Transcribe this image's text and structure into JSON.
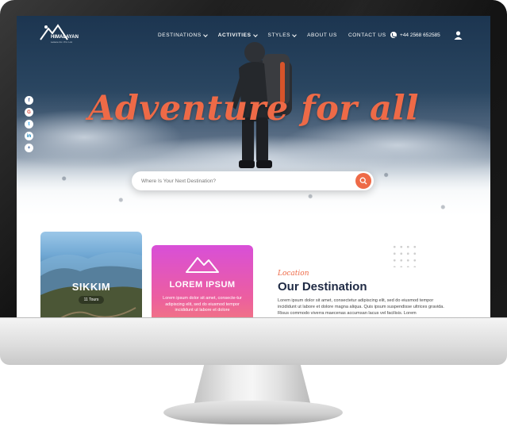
{
  "brand": {
    "name": "HIMALAYAN",
    "sub": "Leisure Inc. Pvt. Ltd."
  },
  "nav": {
    "items": [
      {
        "label": "DESTINATIONS",
        "has_dropdown": true,
        "active": false
      },
      {
        "label": "ACTIVITIES",
        "has_dropdown": true,
        "active": true
      },
      {
        "label": "STYLES",
        "has_dropdown": true,
        "active": false
      },
      {
        "label": "ABOUT US",
        "has_dropdown": false,
        "active": false
      },
      {
        "label": "CONTACT US",
        "has_dropdown": false,
        "active": false
      }
    ],
    "phone": "+44 2568 652585"
  },
  "social": {
    "icons": [
      "facebook-icon",
      "google-icon",
      "twitter-icon",
      "linkedin-icon",
      "share-icon"
    ],
    "labels": [
      "f",
      "G",
      "t",
      "in",
      "+"
    ]
  },
  "hero": {
    "headline": "Adventure for all",
    "search_placeholder": "Where Is Your Next Destination?"
  },
  "cards": {
    "sikkim": {
      "title": "SIKKIM",
      "badge": "11 Tours"
    },
    "lorem": {
      "title": "LOREM IPSUM",
      "body": "Lorem ipsum dolor sit amet, consecte-tur adipiscing elit, sed do eiusmod tempor incididunt ut labore et dolore"
    }
  },
  "destination": {
    "script_label": "Location",
    "title": "Our Destination",
    "body": "Lorem ipsum dolor sit amet, consectetur adipiscing elit, sed do eiusmod tempor incididunt ut labore et dolore magna aliqua. Quis ipsum suspendisse ultrices gravida. Risus commodo viverra maecenas accumsan lacus vel facilisis. Lorem"
  },
  "colors": {
    "accent": "#ee6a47",
    "hero_top": "#1c3550",
    "heading": "#1f2a44"
  }
}
